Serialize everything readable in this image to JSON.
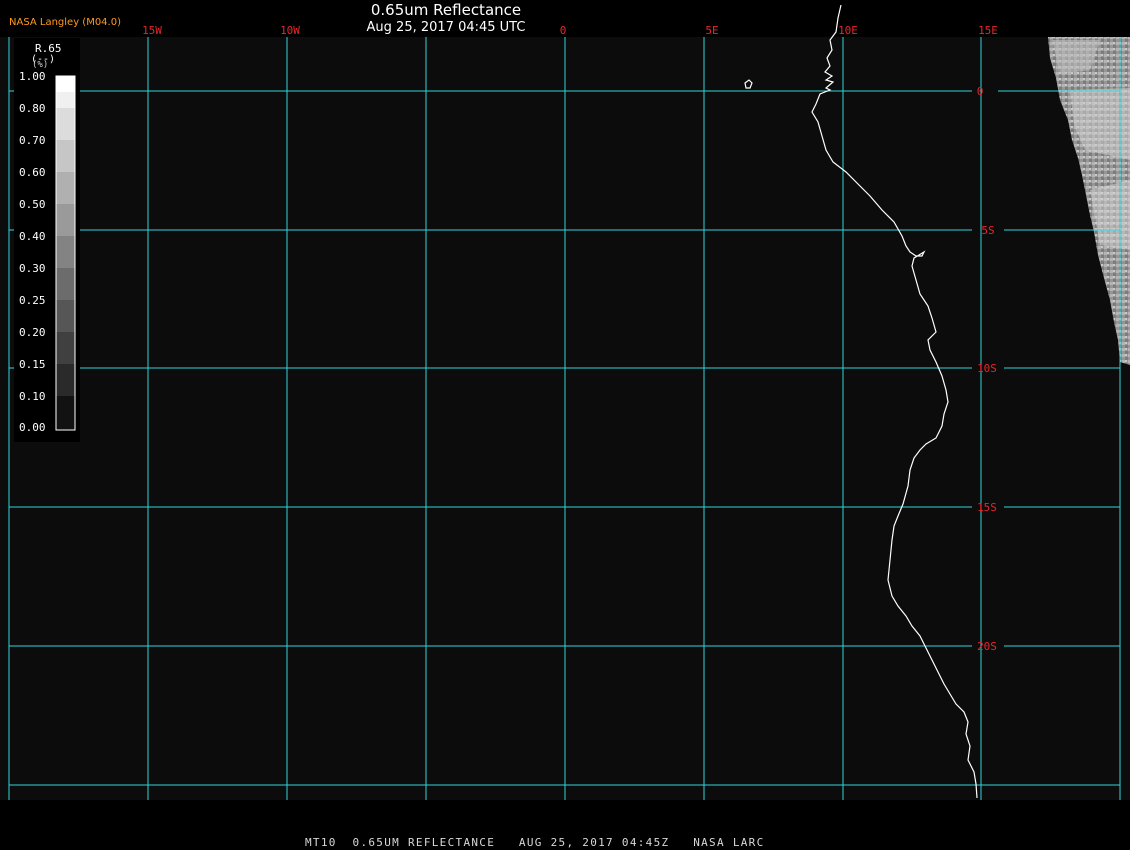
{
  "title": "0.65um Reflectance",
  "subtitle": "Aug 25, 2017 04:45 UTC",
  "credit": "NASA Langley (M04.0)",
  "footer": "MT10  0.65UM REFLECTANCE   AUG 25, 2017 04:45Z   NASA LARC",
  "legend": {
    "variable": "R.65",
    "units": "(--)",
    "percent": "(%)",
    "ticks": [
      "1.00",
      "0.80",
      "0.70",
      "0.60",
      "0.50",
      "0.40",
      "0.30",
      "0.25",
      "0.20",
      "0.15",
      "0.10",
      "0.00"
    ]
  },
  "grid": {
    "longitude_labels": [
      "15W",
      "10W",
      "0",
      "5E",
      "10E",
      "15E"
    ],
    "latitude_labels": [
      "0",
      "5S",
      "10S",
      "15S",
      "20S"
    ]
  },
  "colors": {
    "gridline": "#2fd3d9",
    "grid_label": "#e8252b",
    "coastline": "#ffffff",
    "ocean": "#0c0c0c",
    "credit": "#ff9a1f"
  }
}
